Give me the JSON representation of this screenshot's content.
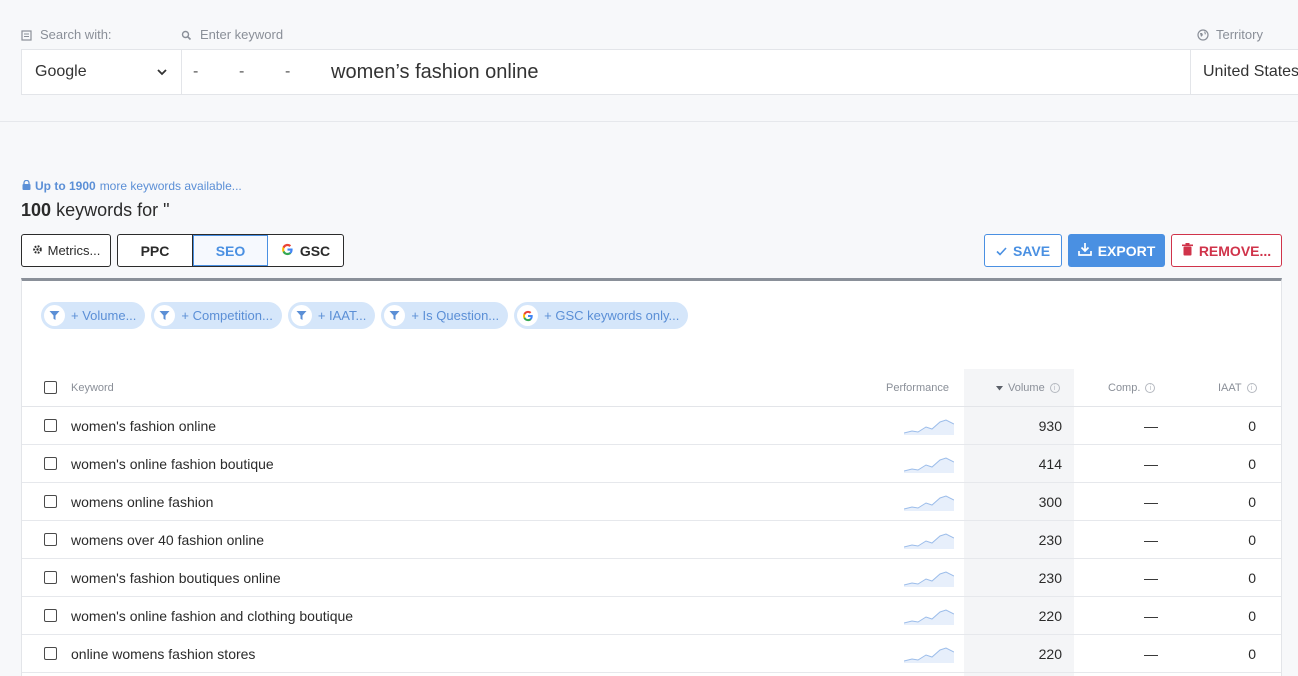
{
  "search": {
    "search_with_label": "Search with:",
    "keyword_label": "Enter keyword",
    "territory_label": "Territory",
    "engine": "Google",
    "dashes": [
      "-",
      "-",
      "-"
    ],
    "keyword_value": "women’s fashion online",
    "territory_value": "United States"
  },
  "summary": {
    "upto_bold": "Up to 1900",
    "upto_rest": "more keywords available...",
    "count_bold": "100",
    "count_rest": "keywords for \""
  },
  "toolbar": {
    "metrics_label": "Metrics...",
    "ppc_label": "PPC",
    "seo_label": "SEO",
    "gsc_label": "GSC",
    "save_label": "SAVE",
    "export_label": "EXPORT",
    "remove_label": "REMOVE..."
  },
  "filters": [
    {
      "label": "+ Volume...",
      "icon": "filter-icon"
    },
    {
      "label": "+ Competition...",
      "icon": "filter-icon"
    },
    {
      "label": "+ IAAT...",
      "icon": "filter-icon"
    },
    {
      "label": "+ Is Question...",
      "icon": "filter-icon"
    },
    {
      "label": "+ GSC keywords only...",
      "icon": "google-icon"
    }
  ],
  "table": {
    "headers": {
      "keyword": "Keyword",
      "performance": "Performance",
      "volume": "Volume",
      "comp": "Comp.",
      "iaat": "IAAT"
    },
    "rows": [
      {
        "keyword": "women's fashion online",
        "volume": "930",
        "comp": "—",
        "iaat": "0"
      },
      {
        "keyword": "women's online fashion boutique",
        "volume": "414",
        "comp": "—",
        "iaat": "0"
      },
      {
        "keyword": "womens online fashion",
        "volume": "300",
        "comp": "—",
        "iaat": "0"
      },
      {
        "keyword": "womens over 40 fashion online",
        "volume": "230",
        "comp": "—",
        "iaat": "0"
      },
      {
        "keyword": "women's fashion boutiques online",
        "volume": "230",
        "comp": "—",
        "iaat": "0"
      },
      {
        "keyword": "women's online fashion and clothing boutique",
        "volume": "220",
        "comp": "—",
        "iaat": "0"
      },
      {
        "keyword": "online womens fashion stores",
        "volume": "220",
        "comp": "—",
        "iaat": "0"
      }
    ]
  },
  "colors": {
    "accent": "#4a90e2",
    "danger": "#d0334a",
    "chip_bg": "#d5e6fa"
  }
}
